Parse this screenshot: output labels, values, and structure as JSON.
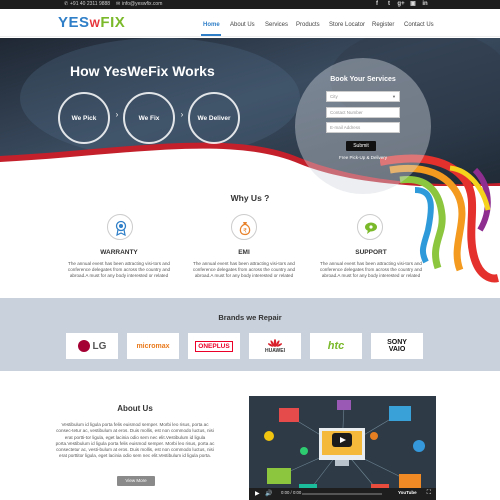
{
  "topbar": {
    "phone": "+91 40 2311 9888",
    "email": "info@yeswfix.com",
    "social": [
      "f",
      "t",
      "g+",
      "▣",
      "in"
    ]
  },
  "logo": {
    "yes": "YES",
    "w": "W",
    "fix": "FIX",
    "colors": {
      "yes": "#2f7fc8",
      "w": "#e6333a",
      "fix": "#7ab929"
    }
  },
  "nav": {
    "items": [
      "Home",
      "About Us",
      "Services",
      "Products",
      "Store Locator",
      "Register",
      "Contact Us"
    ],
    "active": "Home",
    "accent": "#2f7fc8"
  },
  "hero": {
    "title": "How YesWeFix Works",
    "steps": [
      "We Pick",
      "We Fix",
      "We Deliver"
    ],
    "arrow": "›",
    "book": {
      "title": "Book Your Services",
      "city_placeholder": "City",
      "contact_placeholder": "Contact Number",
      "email_placeholder": "E-mail Address",
      "submit": "Submit",
      "note": "Free Pick-Up & Delivery"
    }
  },
  "why": {
    "title": "Why Us ?",
    "features": [
      {
        "title": "WARRANTY",
        "icon": "award-ribbon-icon",
        "desc": "The annual event has been attracting visi-tors and conference delegates from across the country and abroad.A must for any body interested or related"
      },
      {
        "title": "EMI",
        "icon": "money-bag-icon",
        "desc": "The annual event has been attracting visi-tors and conference delegates from across the country and abroad.A must for any body interested or related"
      },
      {
        "title": "SUPPORT",
        "icon": "chat-bubble-icon",
        "desc": "The annual event has been attracting visi-tors and conference delegates from across the country and abroad.A must for any body interested or related"
      }
    ]
  },
  "brands": {
    "title": "Brands we Repair",
    "items": [
      "LG",
      "micromax",
      "ONEPLUS",
      "HUAWEI",
      "htc",
      "SONY VAIO"
    ]
  },
  "about": {
    "title": "About Us",
    "text": "Vestibulum id ligula porta felis euismod semper. Morbi leo risus, porta ac consec-tetur ac, vestibulum at eros. Duis mollis, est non commodo luctus, nisi erat portti-tor ligula, eget lacinia odio sem nec elit.Vestibulum id ligula porta.Vestibulum id ligula porta felis euismod semper. Morbi leo risus, porta ac consectetur ac, vesti-bulum at eros. Duis mollis, est non commodo luctus, nisi erat porttitor ligula, eget lacinia odio sem nec elit.Vestibulum id ligula porta.",
    "button": "View More"
  },
  "video": {
    "time": "0:00 / 0:00",
    "brand": "YouTube"
  }
}
